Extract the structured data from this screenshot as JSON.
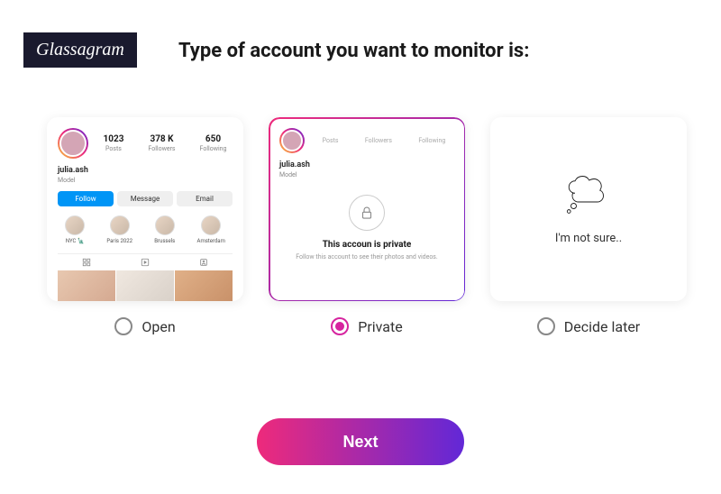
{
  "logo": "Glassagram",
  "heading": "Type of account you want to monitor is:",
  "cards": {
    "open": {
      "stats": [
        {
          "num": "1023",
          "label": "Posts"
        },
        {
          "num": "378 K",
          "label": "Followers"
        },
        {
          "num": "650",
          "label": "Following"
        }
      ],
      "username": "julia.ash",
      "bio": "Model",
      "buttons": [
        "Follow",
        "Message",
        "Email"
      ],
      "highlights": [
        "NYC 🗽",
        "Paris 2022",
        "Brussels",
        "Amsterdam"
      ]
    },
    "private": {
      "stat_labels": [
        "Posts",
        "Followers",
        "Following"
      ],
      "username": "julia.ash",
      "bio": "Model",
      "title": "This accoun is private",
      "subtitle": "Follow this account to see their photos and videos."
    },
    "decide": {
      "text": "I'm not sure.."
    }
  },
  "options": [
    {
      "label": "Open",
      "selected": false
    },
    {
      "label": "Private",
      "selected": true
    },
    {
      "label": "Decide later",
      "selected": false
    }
  ],
  "next_button": "Next",
  "colors": {
    "gradient_start": "#ee2a7b",
    "gradient_end": "#6228d7",
    "radio_active": "#d6249f"
  }
}
